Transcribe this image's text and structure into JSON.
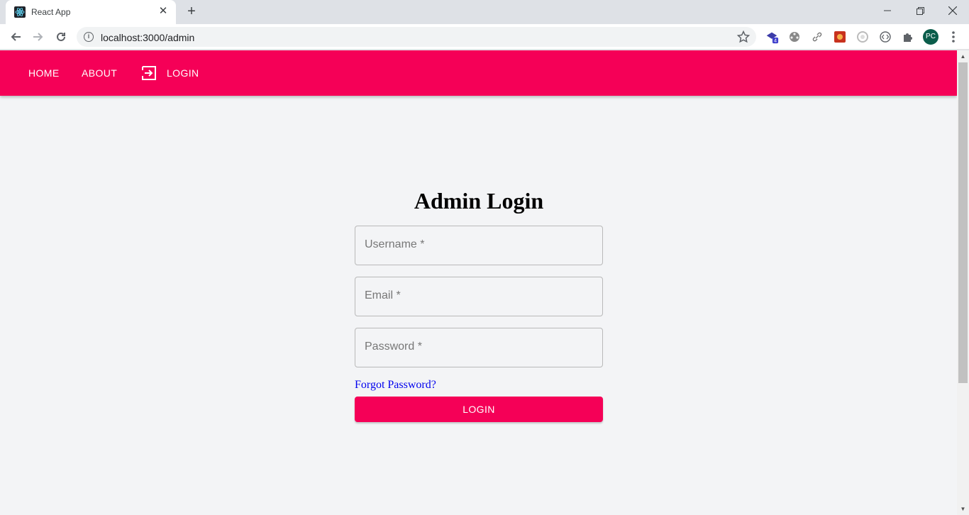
{
  "browser": {
    "tab_title": "React App",
    "url": "localhost:3000/admin",
    "profile_initials": "PC",
    "extension_badge": "4"
  },
  "nav": {
    "home": "HOME",
    "about": "ABOUT",
    "login": "LOGIN"
  },
  "form": {
    "title": "Admin Login",
    "username_label": "Username *",
    "email_label": "Email *",
    "password_label": "Password *",
    "forgot_link": "Forgot Password?",
    "login_button": "LOGIN"
  },
  "colors": {
    "accent": "#f50057",
    "background": "#f3f4f6",
    "link": "#0000ee"
  }
}
